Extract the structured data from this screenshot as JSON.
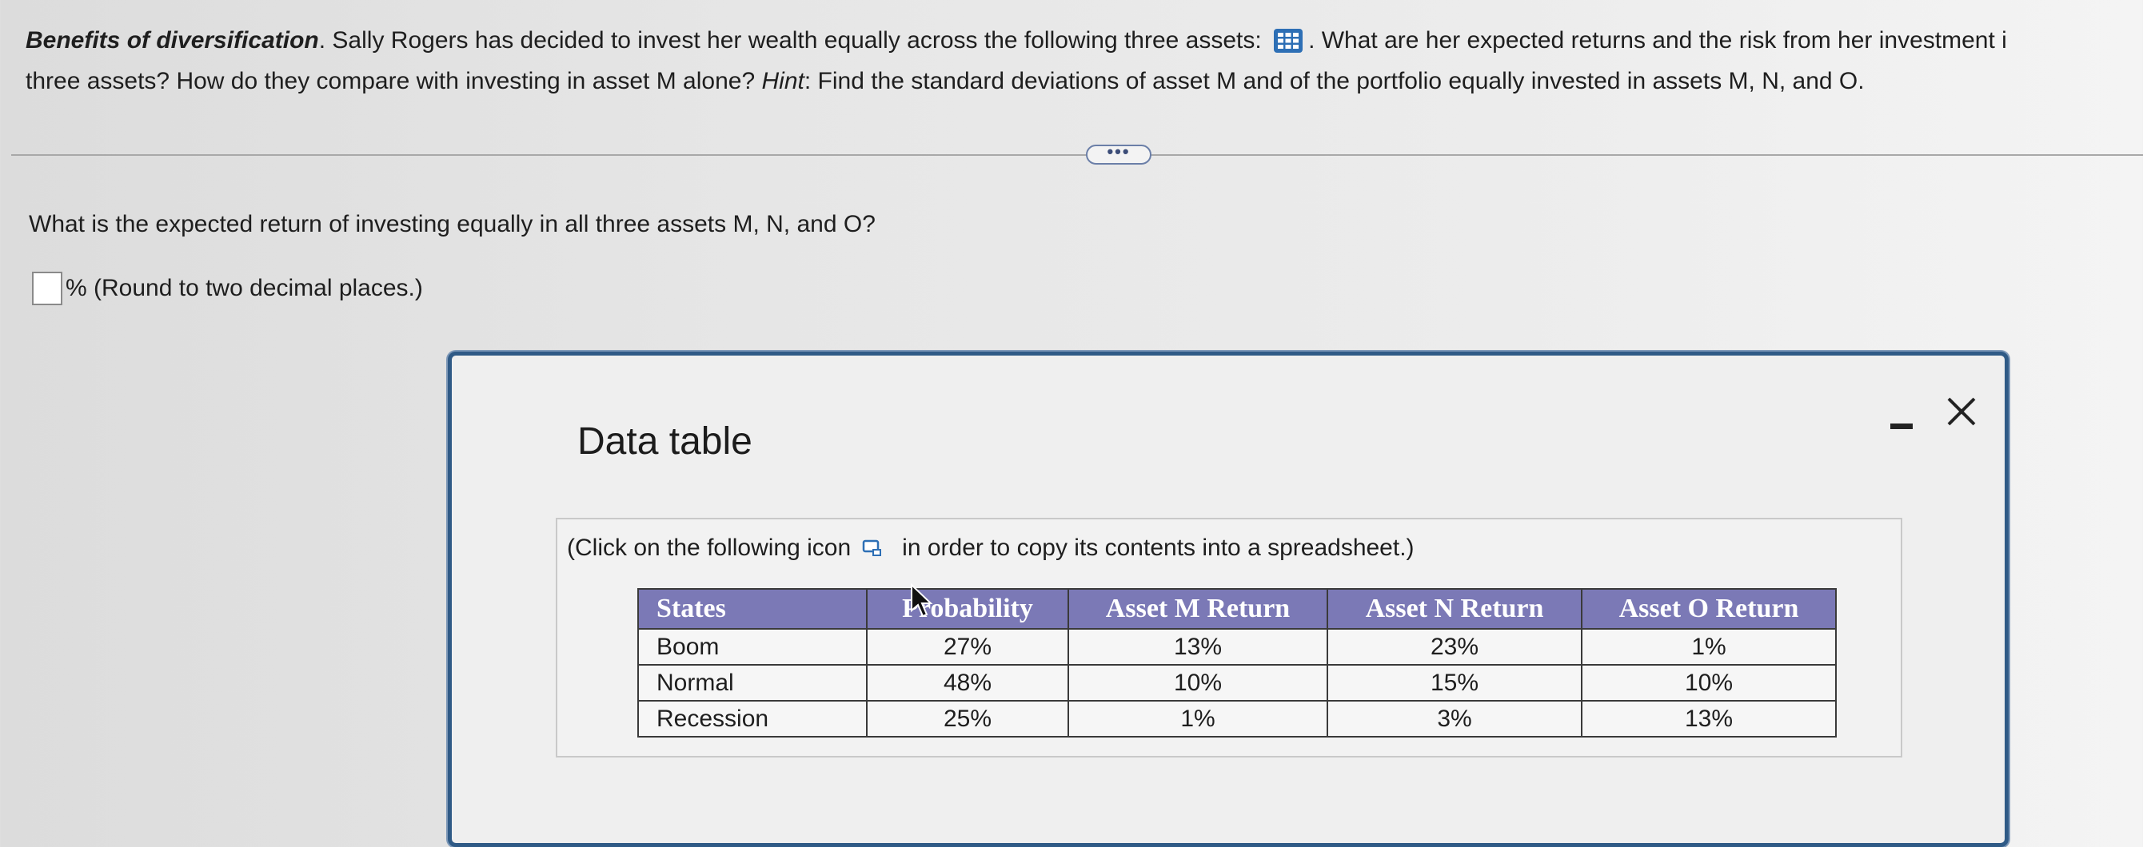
{
  "question": {
    "title": "Benefits of diversification",
    "line1_rest": ". Sally Rogers has decided to invest her wealth equally across the following three assets:",
    "line1_after_icon": ". What are her expected returns and the risk from her investment i",
    "line2_start": "three assets? How do they compare with investing in asset M alone?",
    "hint_label": "Hint",
    "hint_text": ": Find the standard deviations of asset M and of the portfolio equally invested in assets M, N, and O.",
    "more_label": "•••"
  },
  "sub_question": {
    "text": "What is the expected return of investing equally in all three assets M, N, and O?",
    "answer_value": "",
    "unit_suffix": "% (Round to two decimal places.)"
  },
  "modal": {
    "title": "Data table",
    "copy_note_before": "(Click on the following icon",
    "copy_note_after": "in order to copy its contents into a spreadsheet.)",
    "table": {
      "headers": [
        "States",
        "Probability",
        "Asset M Return",
        "Asset N Return",
        "Asset O Return"
      ],
      "rows": [
        [
          "Boom",
          "27%",
          "13%",
          "23%",
          "1%"
        ],
        [
          "Normal",
          "48%",
          "10%",
          "15%",
          "10%"
        ],
        [
          "Recession",
          "25%",
          "1%",
          "3%",
          "13%"
        ]
      ]
    }
  },
  "colors": {
    "header_bg": "#7b79b6",
    "modal_border": "#2f5a86",
    "icon_blue": "#2d6fb5"
  },
  "icons": [
    "data-grid-icon",
    "minimize-icon",
    "close-icon",
    "copy-icon",
    "mouse-cursor-icon"
  ]
}
